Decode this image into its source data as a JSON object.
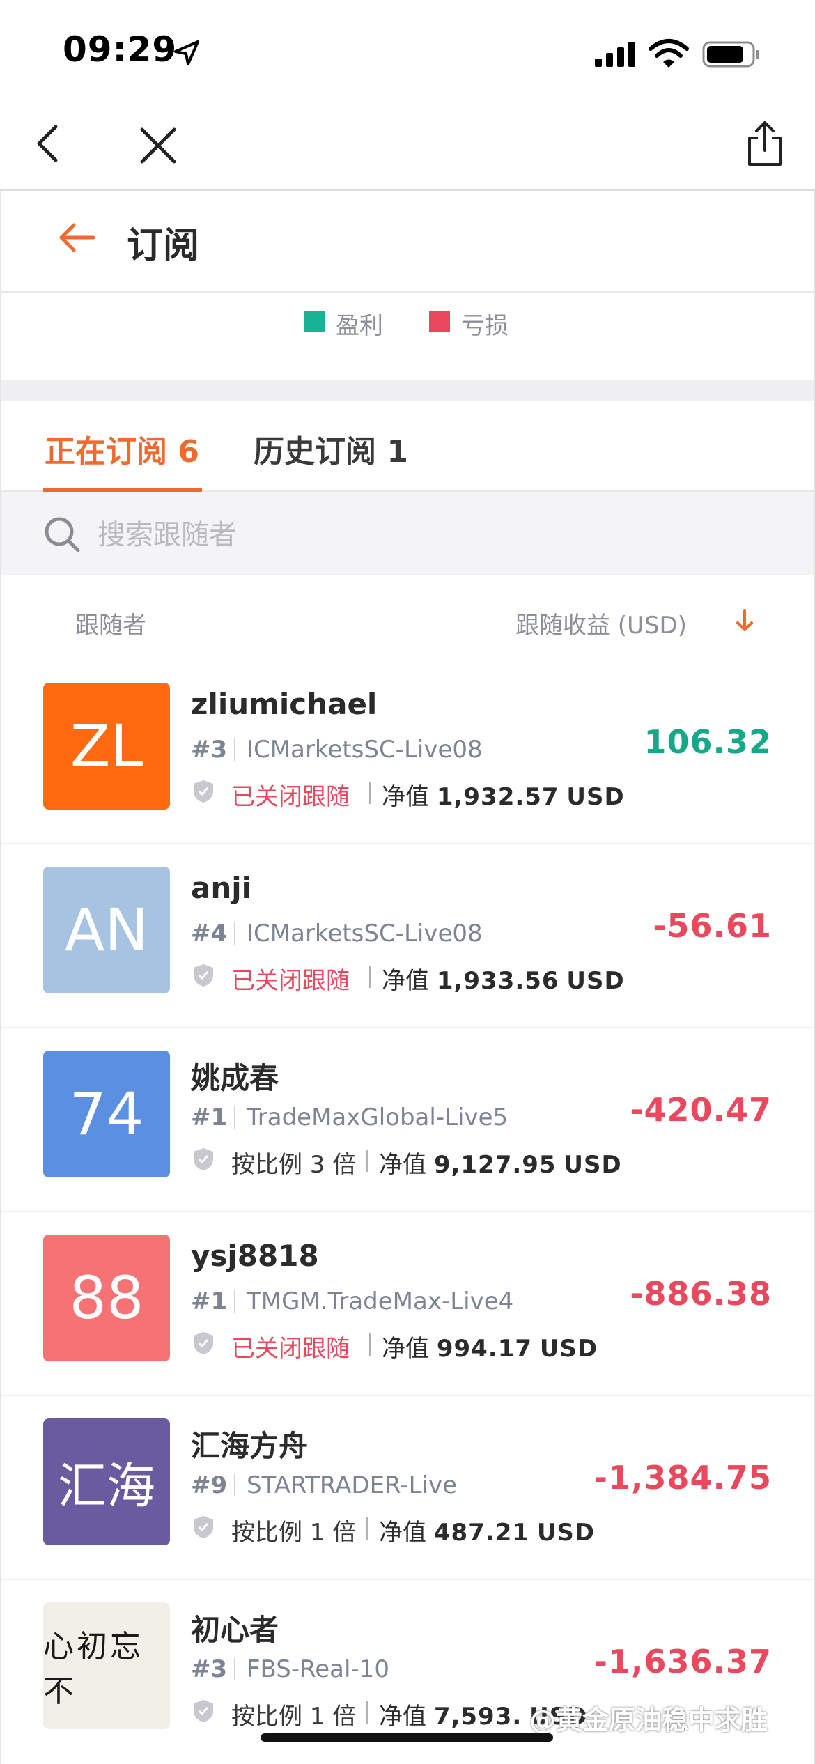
{
  "status_bar": {
    "time": "09:29"
  },
  "header": {
    "title": "订阅"
  },
  "legend": {
    "profit_label": "盈利",
    "loss_label": "亏损",
    "profit_color": "#17b394",
    "loss_color": "#e9485d"
  },
  "tabs": [
    {
      "label": "正在订阅 6",
      "active": true
    },
    {
      "label": "历史订阅 1",
      "active": false
    }
  ],
  "search": {
    "placeholder": "搜索跟随者"
  },
  "columns": {
    "follower": "跟随者",
    "profit": "跟随收益 (USD)"
  },
  "rows": [
    {
      "avatar_text": "ZL",
      "avatar_color": "#ff6a10",
      "name": "zliumichael",
      "rank": "#3",
      "server": "ICMarketsSC-Live08",
      "status": "已关闭跟随",
      "status_type": "closed",
      "net_label": "净值",
      "net_value": "1,932.57",
      "currency": "USD",
      "profit": "106.32",
      "profit_sign": "positive"
    },
    {
      "avatar_text": "AN",
      "avatar_color": "#a6c4e2",
      "name": "anji",
      "rank": "#4",
      "server": "ICMarketsSC-Live08",
      "status": "已关闭跟随",
      "status_type": "closed",
      "net_label": "净值",
      "net_value": "1,933.56",
      "currency": "USD",
      "profit": "-56.61",
      "profit_sign": "negative"
    },
    {
      "avatar_text": "74",
      "avatar_color": "#5b8fe0",
      "name": "姚成春",
      "rank": "#1",
      "server": "TradeMaxGlobal-Live5",
      "status": "按比例 3 倍",
      "status_type": "ratio",
      "net_label": "净值",
      "net_value": "9,127.95",
      "currency": "USD",
      "profit": "-420.47",
      "profit_sign": "negative"
    },
    {
      "avatar_text": "88",
      "avatar_color": "#f77274",
      "name": "ysj8818",
      "rank": "#1",
      "server": "TMGM.TradeMax-Live4",
      "status": "已关闭跟随",
      "status_type": "closed",
      "net_label": "净值",
      "net_value": "994.17",
      "currency": "USD",
      "profit": "-886.38",
      "profit_sign": "negative"
    },
    {
      "avatar_text": "汇海",
      "avatar_color": "#6a5aa0",
      "name": "汇海方舟",
      "rank": "#9",
      "server": "STARTRADER-Live",
      "status": "按比例 1 倍",
      "status_type": "ratio",
      "net_label": "净值",
      "net_value": "487.21",
      "currency": "USD",
      "profit": "-1,384.75",
      "profit_sign": "negative"
    },
    {
      "avatar_text": "心初忘不",
      "avatar_color": "#f1efe8",
      "name": "初心者",
      "rank": "#3",
      "server": "FBS-Real-10",
      "status": "按比例 1 倍",
      "status_type": "ratio",
      "net_label": "净值",
      "net_value": "7,593.",
      "currency": "USD",
      "profit": "-1,636.37",
      "profit_sign": "negative"
    }
  ],
  "watermark": "@黄金原油稳中求胜",
  "icons": [
    "location-arrow-icon",
    "signal-icon",
    "wifi-icon",
    "battery-icon",
    "chevron-left-icon",
    "close-icon",
    "share-icon",
    "back-arrow-icon",
    "search-icon",
    "sort-down-arrow-icon",
    "shield-icon"
  ]
}
